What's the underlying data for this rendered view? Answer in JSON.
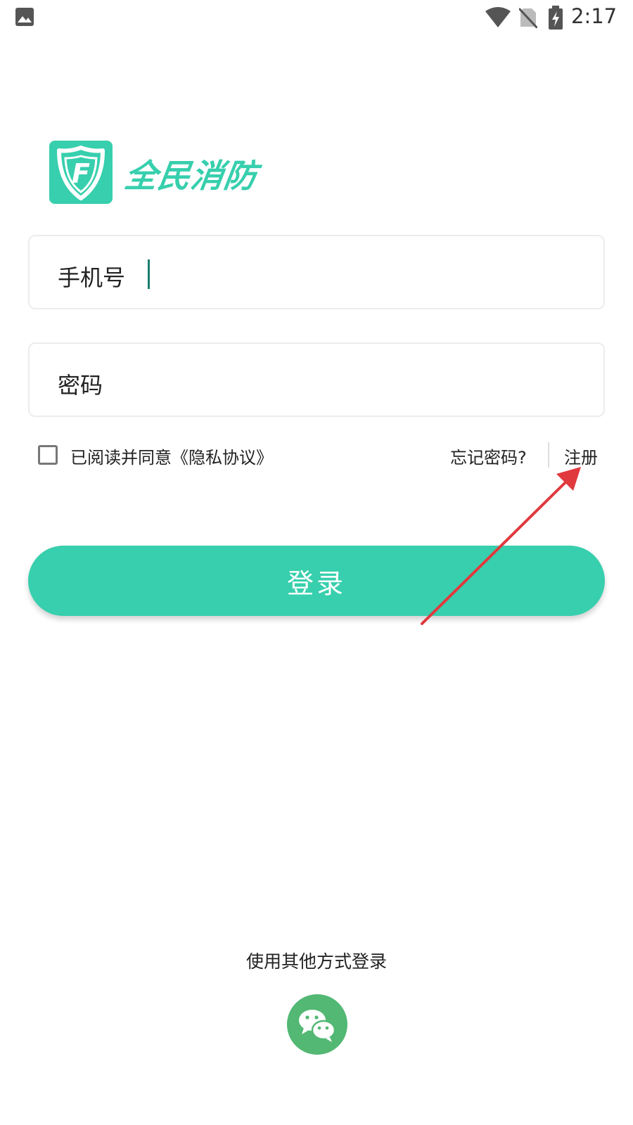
{
  "status_bar": {
    "time": "2:17",
    "icons": [
      "image-icon",
      "wifi-icon",
      "no-sim-icon",
      "battery-charging-icon"
    ]
  },
  "logo": {
    "badge_letter": "F",
    "app_name": "全民消防",
    "brand_color": "#37cfad"
  },
  "form": {
    "phone_label": "手机号",
    "phone_value": "",
    "password_label": "密码",
    "password_value": ""
  },
  "options": {
    "agree_checked": false,
    "agree_text": "已阅读并同意《隐私协议》",
    "forgot_password": "忘记密码?",
    "register": "注册"
  },
  "login_button": {
    "label": "登录",
    "color": "#37cfad"
  },
  "other_login": {
    "label": "使用其他方式登录",
    "wechat_icon": "wechat-icon",
    "wechat_color": "#52b873"
  },
  "annotation": {
    "type": "arrow",
    "color": "#e0393e",
    "points_to": "register"
  }
}
